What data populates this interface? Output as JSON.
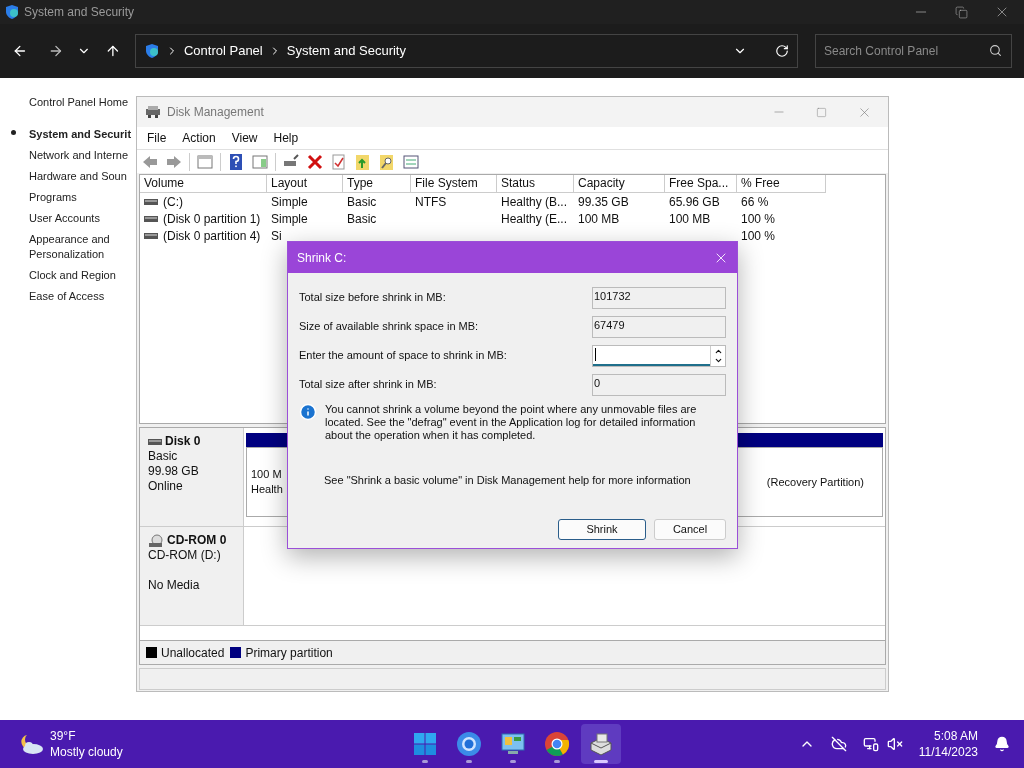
{
  "window": {
    "title": "System and Security",
    "breadcrumb": [
      "Control Panel",
      "System and Security"
    ],
    "search": {
      "placeholder": "Search Control Panel"
    }
  },
  "sidebar": {
    "items": [
      {
        "label": "Control Panel Home",
        "selected": false,
        "kind": "home"
      },
      {
        "label": "System and Securit",
        "selected": true,
        "kind": "category"
      },
      {
        "label": "Network and Interne",
        "selected": false,
        "kind": "category"
      },
      {
        "label": "Hardware and Soun",
        "selected": false,
        "kind": "category"
      },
      {
        "label": "Programs",
        "selected": false,
        "kind": "category"
      },
      {
        "label": "User Accounts",
        "selected": false,
        "kind": "category"
      },
      {
        "label": "Appearance and Personalization",
        "selected": false,
        "kind": "category"
      },
      {
        "label": "Clock and Region",
        "selected": false,
        "kind": "category"
      },
      {
        "label": "Ease of Access",
        "selected": false,
        "kind": "category"
      }
    ]
  },
  "disk_management": {
    "title": "Disk Management",
    "menu": [
      "File",
      "Action",
      "View",
      "Help"
    ],
    "table": {
      "columns": [
        "Volume",
        "Layout",
        "Type",
        "File System",
        "Status",
        "Capacity",
        "Free Spa...",
        "% Free"
      ],
      "rows": [
        {
          "volume": "(C:)",
          "layout": "Simple",
          "type": "Basic",
          "file_system": "NTFS",
          "status": "Healthy (B...",
          "capacity": "99.35 GB",
          "free_space": "65.96 GB",
          "pct_free": "66 %"
        },
        {
          "volume": "(Disk 0 partition 1)",
          "layout": "Simple",
          "type": "Basic",
          "status": "Healthy (E...",
          "capacity": "100 MB",
          "free_space": "100 MB",
          "pct_free": "100 %"
        },
        {
          "volume": "(Disk 0 partition 4)",
          "layout": "Si",
          "pct_free": "100 %"
        }
      ]
    },
    "disks": [
      {
        "kind": "disk",
        "name": "Disk 0",
        "details": [
          "Basic",
          "99.98 GB",
          "Online"
        ],
        "partitions": [
          {
            "lines": [
              "100 M",
              "Health"
            ]
          },
          {
            "lines": [
              "(Recovery Partition)"
            ]
          }
        ]
      },
      {
        "kind": "cdrom",
        "name": "CD-ROM 0",
        "details": [
          "CD-ROM (D:)",
          "No Media"
        ]
      }
    ],
    "legend": [
      {
        "label": "Unallocated",
        "color": "#000000"
      },
      {
        "label": "Primary partition",
        "color": "#000080"
      }
    ]
  },
  "dialog": {
    "title": "Shrink C:",
    "fields": [
      {
        "label": "Total size before shrink in MB:",
        "kind": "readonly",
        "value": "101732"
      },
      {
        "label": "Size of available shrink space in MB:",
        "kind": "readonly",
        "value": "67479"
      },
      {
        "label": "Enter the amount of space to shrink in MB:",
        "kind": "spin",
        "focused": true
      },
      {
        "label": "Total size after shrink in MB:",
        "kind": "readonly",
        "value": "0"
      }
    ],
    "info": "You cannot shrink a volume beyond the point where any unmovable files are located. See the \"defrag\" event in the Application log for detailed information about the operation when it has completed.",
    "help": "See \"Shrink a basic volume\" in Disk Management help for more information",
    "buttons": [
      {
        "label": "Shrink",
        "default": true
      },
      {
        "label": "Cancel",
        "default": false
      }
    ]
  },
  "taskbar": {
    "weather": {
      "temperature": "39°F",
      "condition": "Mostly cloudy"
    },
    "apps": [
      {
        "kind": "start",
        "selected": false
      },
      {
        "kind": "browser-blue",
        "selected": false
      },
      {
        "kind": "control-panel",
        "selected": false
      },
      {
        "kind": "chrome",
        "selected": false
      },
      {
        "kind": "disk-management",
        "selected": true
      }
    ],
    "clock": {
      "time": "5:08 AM",
      "date": "11/14/2023"
    }
  }
}
